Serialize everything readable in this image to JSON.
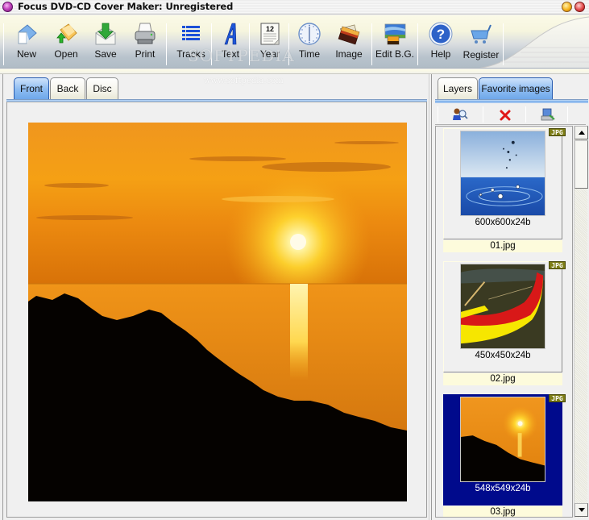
{
  "window": {
    "title": "Focus DVD-CD Cover Maker: Unregistered"
  },
  "toolbar": {
    "buttons": [
      {
        "id": "new",
        "label": "New",
        "icon": "new-document-icon"
      },
      {
        "id": "open",
        "label": "Open",
        "icon": "open-folder-icon"
      },
      {
        "id": "save",
        "label": "Save",
        "icon": "save-icon"
      },
      {
        "id": "print",
        "label": "Print",
        "icon": "printer-icon"
      },
      {
        "id": "tracks",
        "label": "Tracks",
        "icon": "tracks-list-icon"
      },
      {
        "id": "text",
        "label": "Text",
        "icon": "text-icon"
      },
      {
        "id": "year",
        "label": "Year",
        "icon": "calendar-icon",
        "calendar_day": "12"
      },
      {
        "id": "time",
        "label": "Time",
        "icon": "clock-icon"
      },
      {
        "id": "image",
        "label": "Image",
        "icon": "image-icon"
      },
      {
        "id": "edit_bg",
        "label": "Edit B.G.",
        "icon": "edit-background-icon"
      },
      {
        "id": "help",
        "label": "Help",
        "icon": "help-icon"
      },
      {
        "id": "register",
        "label": "Register",
        "icon": "cart-icon"
      }
    ]
  },
  "watermark": {
    "brand": "SOFTPEDIA",
    "url": "www.softpedia.com"
  },
  "left_panel": {
    "tabs": [
      {
        "label": "Front",
        "active": true
      },
      {
        "label": "Back",
        "active": false
      },
      {
        "label": "Disc",
        "active": false
      }
    ]
  },
  "right_panel": {
    "tabs": [
      {
        "label": "Layers",
        "active": false
      },
      {
        "label": "Favorite images",
        "active": true
      }
    ],
    "tools": [
      {
        "id": "browse",
        "icon": "browse-images-icon"
      },
      {
        "id": "delete",
        "icon": "delete-icon"
      },
      {
        "id": "find",
        "icon": "find-image-icon"
      }
    ],
    "favorites": [
      {
        "name": "01.jpg",
        "dims": "600x600x24b",
        "type": "JPG",
        "selected": false
      },
      {
        "name": "02.jpg",
        "dims": "450x450x24b",
        "type": "JPG",
        "selected": false
      },
      {
        "name": "03.jpg",
        "dims": "548x549x24b",
        "type": "JPG",
        "selected": true
      }
    ],
    "scroll_position": 0.1
  },
  "colors": {
    "selection": "#000a8c",
    "tab_active": "#6ca6ea",
    "badge": "#7d7d16"
  }
}
